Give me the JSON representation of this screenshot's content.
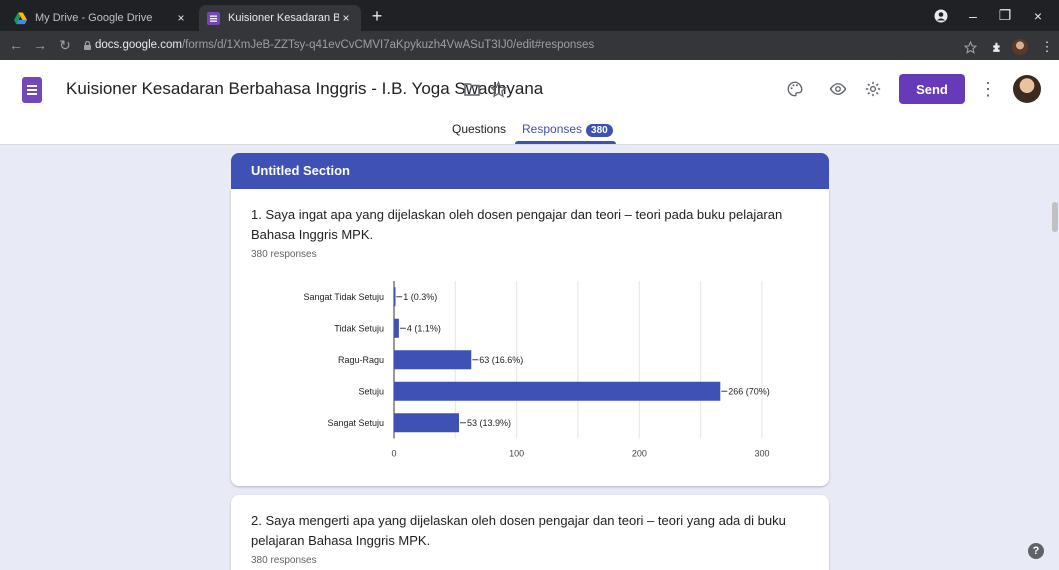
{
  "browser": {
    "tabs": [
      {
        "title": "My Drive - Google Drive",
        "close": "×"
      },
      {
        "title": "Kuisioner Kesadaran Berbahasa I",
        "close": "×"
      }
    ],
    "new_tab": "+",
    "window_controls": {
      "minimize": "–",
      "maximize": "❐",
      "close": "×"
    },
    "url_host": "docs.google.com",
    "url_path": "/forms/d/1XmJeB-ZZTsy-q41evCvCMVI7aKpykuzh4VwASuT3IJ0/edit#responses"
  },
  "header": {
    "title": "Kuisioner Kesadaran Berbahasa Inggris - I.B. Yoga Swadnyana",
    "send_label": "Send",
    "accent": "#673ab7"
  },
  "form_tabs": {
    "questions": "Questions",
    "responses": "Responses",
    "responses_count": "380"
  },
  "section": {
    "title": "Untitled Section"
  },
  "questions": [
    {
      "title": "1. Saya ingat apa yang dijelaskan oleh dosen pengajar dan teori – teori pada buku pelajaran Bahasa Inggris MPK.",
      "responses": "380 responses"
    },
    {
      "title": "2. Saya mengerti apa yang dijelaskan oleh dosen pengajar dan teori – teori yang ada di buku pelajaran Bahasa Inggris MPK.",
      "responses": "380 responses"
    }
  ],
  "chart_data": {
    "type": "bar",
    "orientation": "horizontal",
    "categories": [
      "Sangat Tidak Setuju",
      "Tidak Setuju",
      "Ragu-Ragu",
      "Setuju",
      "Sangat Setuju"
    ],
    "values": [
      1,
      4,
      63,
      266,
      53
    ],
    "data_labels": [
      "1 (0.3%)",
      "4 (1.1%)",
      "63 (16.6%)",
      "266 (70%)",
      "53 (13.9%)"
    ],
    "xticks": [
      "0",
      "100",
      "200",
      "300"
    ],
    "xlim": [
      0,
      300
    ],
    "grid": true,
    "bar_color": "#3f51b5"
  },
  "help_label": "?"
}
